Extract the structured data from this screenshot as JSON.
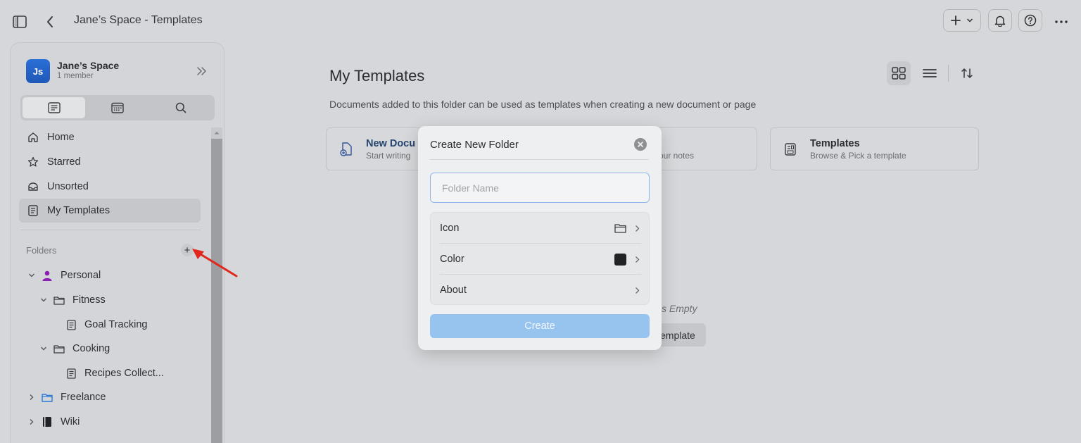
{
  "header": {
    "title": "Jane’s Space - Templates"
  },
  "sidebar": {
    "space": {
      "initials": "Js",
      "name": "Jane’s Space",
      "members": "1 member"
    },
    "nav": [
      {
        "label": "Home",
        "icon": "home-icon"
      },
      {
        "label": "Starred",
        "icon": "star-icon"
      },
      {
        "label": "Unsorted",
        "icon": "inbox-icon"
      },
      {
        "label": "My Templates",
        "icon": "template-icon",
        "active": true
      }
    ],
    "folders_label": "Folders",
    "add_folder_label": "+",
    "tree": [
      {
        "label": "Personal",
        "icon": "person-icon",
        "expanded": true,
        "depth": 0
      },
      {
        "label": "Fitness",
        "icon": "folder-icon",
        "expanded": true,
        "depth": 1
      },
      {
        "label": "Goal Tracking",
        "icon": "document-icon",
        "depth": 2
      },
      {
        "label": "Cooking",
        "icon": "folder-icon",
        "expanded": true,
        "depth": 1
      },
      {
        "label": "Recipes Collect...",
        "icon": "document-icon",
        "depth": 2
      },
      {
        "label": "Freelance",
        "icon": "folder-icon",
        "expanded": false,
        "depth": 0,
        "icon_color": "#2a78d8"
      },
      {
        "label": "Wiki",
        "icon": "book-icon",
        "expanded": false,
        "depth": 0
      }
    ]
  },
  "main": {
    "title": "My Templates",
    "description": "Documents added to this folder can be used as templates when creating a new document or page",
    "cards": [
      {
        "title": "New Docu",
        "subtitle": "Start writing"
      },
      {
        "title": "",
        "subtitle": "our notes"
      },
      {
        "title": "Templates",
        "subtitle": "Browse & Pick a template"
      }
    ],
    "empty_text": "s Empty",
    "empty_button": "emplate"
  },
  "modal": {
    "title": "Create New Folder",
    "input_placeholder": "Folder Name",
    "input_value": "",
    "rows": [
      {
        "label": "Icon"
      },
      {
        "label": "Color",
        "value_color": "#222326"
      },
      {
        "label": "About"
      }
    ],
    "create_label": "Create"
  },
  "colors": {
    "accent": "#97c3ef",
    "avatar": "#1f58b8",
    "annotation": "#e0281e"
  }
}
